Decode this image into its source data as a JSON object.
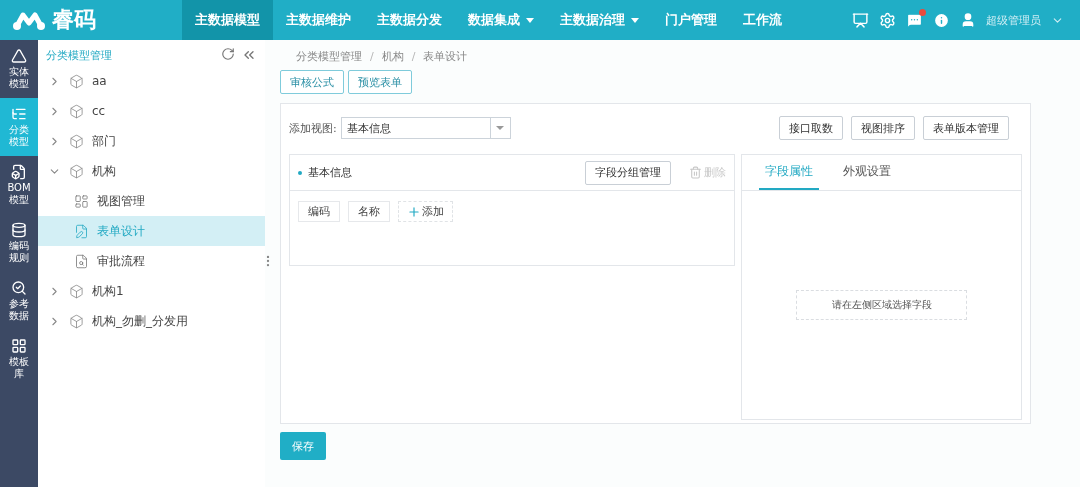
{
  "header": {
    "brand": "睿码",
    "nav": [
      {
        "label": "主数据模型",
        "selected": true,
        "dropdown": false
      },
      {
        "label": "主数据维护",
        "selected": false,
        "dropdown": false
      },
      {
        "label": "主数据分发",
        "selected": false,
        "dropdown": false
      },
      {
        "label": "数据集成",
        "selected": false,
        "dropdown": true
      },
      {
        "label": "主数据治理",
        "selected": false,
        "dropdown": true
      },
      {
        "label": "门户管理",
        "selected": false,
        "dropdown": false
      },
      {
        "label": "工作流",
        "selected": false,
        "dropdown": false
      }
    ],
    "icons": [
      {
        "kind": "monitor",
        "alert": false
      },
      {
        "kind": "settings",
        "alert": false
      },
      {
        "kind": "messages",
        "alert": true
      },
      {
        "kind": "info",
        "alert": false
      }
    ],
    "user": "超级管理员"
  },
  "rail": [
    {
      "kind": "entity",
      "label": "实体模型",
      "selected": false
    },
    {
      "kind": "category",
      "label": "分类模型",
      "selected": true
    },
    {
      "kind": "bom",
      "label": "BOM模型",
      "selected": false
    },
    {
      "kind": "code",
      "label": "编码规则",
      "selected": false
    },
    {
      "kind": "reference",
      "label": "参考数据",
      "selected": false
    },
    {
      "kind": "template",
      "label": "模板库",
      "selected": false
    }
  ],
  "tree": {
    "title": "分类模型管理",
    "items": [
      {
        "label": "aa",
        "kind": "model",
        "expanded": false,
        "selected": false
      },
      {
        "label": "cc",
        "kind": "model",
        "expanded": false,
        "selected": false
      },
      {
        "label": "部门",
        "kind": "model",
        "expanded": false,
        "selected": false
      },
      {
        "label": "机构",
        "kind": "model",
        "expanded": true,
        "selected": false,
        "children": [
          {
            "label": "视图管理",
            "kind": "view",
            "selected": false
          },
          {
            "label": "表单设计",
            "kind": "form",
            "selected": true
          },
          {
            "label": "审批流程",
            "kind": "approval",
            "selected": false
          }
        ]
      },
      {
        "label": "机构1",
        "kind": "model",
        "expanded": false,
        "selected": false
      },
      {
        "label": "机构_勿删_分发用",
        "kind": "model",
        "expanded": false,
        "selected": false
      }
    ]
  },
  "breadcrumb": [
    {
      "kind": "link",
      "text": "分类模型管理"
    },
    {
      "kind": "separator",
      "text": "/"
    },
    {
      "kind": "link",
      "text": "机构"
    },
    {
      "kind": "separator",
      "text": "/"
    },
    {
      "kind": "link",
      "text": "表单设计"
    }
  ],
  "top_buttons": [
    "审核公式",
    "预览表单"
  ],
  "view_select": {
    "label": "添加视图:",
    "value": "基本信息"
  },
  "right_buttons": [
    "接口取数",
    "视图排序",
    "表单版本管理"
  ],
  "group": {
    "title": "基本信息",
    "manage_button": "字段分组管理",
    "delete": {
      "label": "删除",
      "disabled": true
    },
    "fields": [
      "编码",
      "名称"
    ],
    "add": "添加"
  },
  "property_tabs": [
    {
      "label": "字段属性",
      "selected": true
    },
    {
      "label": "外观设置",
      "selected": false
    }
  ],
  "placeholder_hint": "请在左侧区域选择字段",
  "save_button": "保存"
}
